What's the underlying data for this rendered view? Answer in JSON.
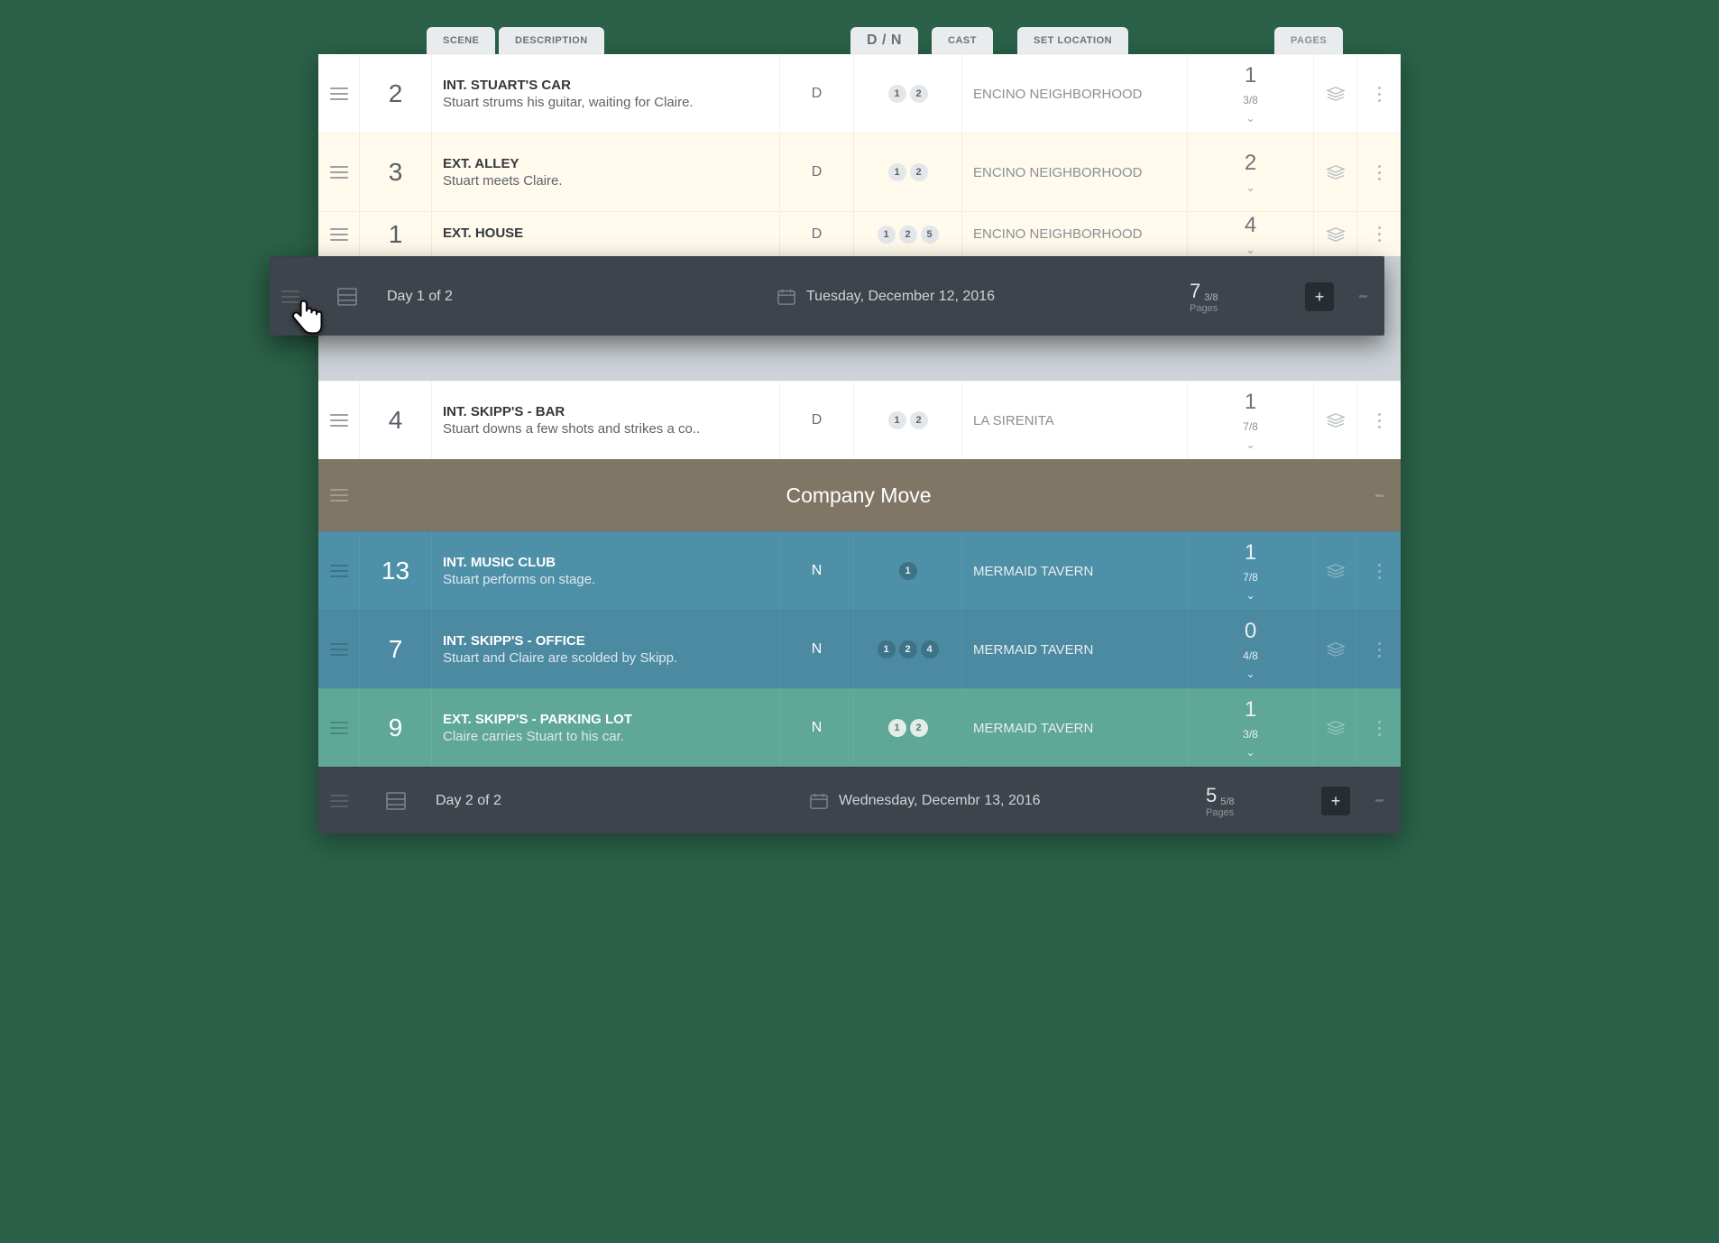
{
  "columns": {
    "scene": "SCENE",
    "description": "DESCRIPTION",
    "dn": "D / N",
    "cast": "CAST",
    "location": "SET LOCATION",
    "pages": "PAGES"
  },
  "scenes": [
    {
      "num": "2",
      "title": "INT. STUART'S CAR",
      "sub": "Stuart strums his guitar, waiting for Claire.",
      "dn": "D",
      "cast": [
        "1",
        "2"
      ],
      "loc": "ENCINO NEIGHBORHOOD",
      "pg_big": "1",
      "pg_frac": "3/8",
      "theme": "white"
    },
    {
      "num": "3",
      "title": "EXT. ALLEY",
      "sub": "Stuart meets Claire.",
      "dn": "D",
      "cast": [
        "1",
        "2"
      ],
      "loc": "ENCINO NEIGHBORHOOD",
      "pg_big": "2",
      "pg_frac": "",
      "theme": "cream"
    },
    {
      "num": "1",
      "title": "EXT. HOUSE",
      "sub": "",
      "dn": "D",
      "cast": [
        "1",
        "2",
        "5"
      ],
      "loc": "ENCINO NEIGHBORHOOD",
      "pg_big": "4",
      "pg_frac": "",
      "theme": "cream",
      "clipped": true
    },
    {
      "num": "4",
      "title": "INT. SKIPP'S - BAR",
      "sub": "Stuart downs a few shots and strikes a co..",
      "dn": "D",
      "cast": [
        "1",
        "2"
      ],
      "loc": "LA SIRENITA",
      "pg_big": "1",
      "pg_frac": "7/8",
      "theme": "white"
    },
    {
      "num": "13",
      "title": "INT. MUSIC CLUB",
      "sub": "Stuart performs on stage.",
      "dn": "N",
      "cast": [
        "1"
      ],
      "loc": "MERMAID TAVERN",
      "pg_big": "1",
      "pg_frac": "7/8",
      "theme": "blue"
    },
    {
      "num": "7",
      "title": "INT. SKIPP'S - OFFICE",
      "sub": "Stuart and Claire are scolded by Skipp.",
      "dn": "N",
      "cast": [
        "1",
        "2",
        "4"
      ],
      "loc": "MERMAID TAVERN",
      "pg_big": "0",
      "pg_frac": "4/8",
      "theme": "blue-d"
    },
    {
      "num": "9",
      "title": "EXT. SKIPP'S - PARKING LOT",
      "sub": "Claire carries Stuart to his car.",
      "dn": "N",
      "cast": [
        "1",
        "2"
      ],
      "loc": "MERMAID TAVERN",
      "pg_big": "1",
      "pg_frac": "3/8",
      "theme": "teal"
    }
  ],
  "day1": {
    "label": "Day 1 of 2",
    "date": "Tuesday, December 12, 2016",
    "pg_big": "7",
    "pg_frac": "3/8",
    "pages_word": "Pages"
  },
  "day2": {
    "label": "Day 2 of 2",
    "date": "Wednesday, Decembr 13, 2016",
    "pg_big": "5",
    "pg_frac": "5/8",
    "pages_word": "Pages"
  },
  "banner": {
    "title": "Company Move"
  }
}
